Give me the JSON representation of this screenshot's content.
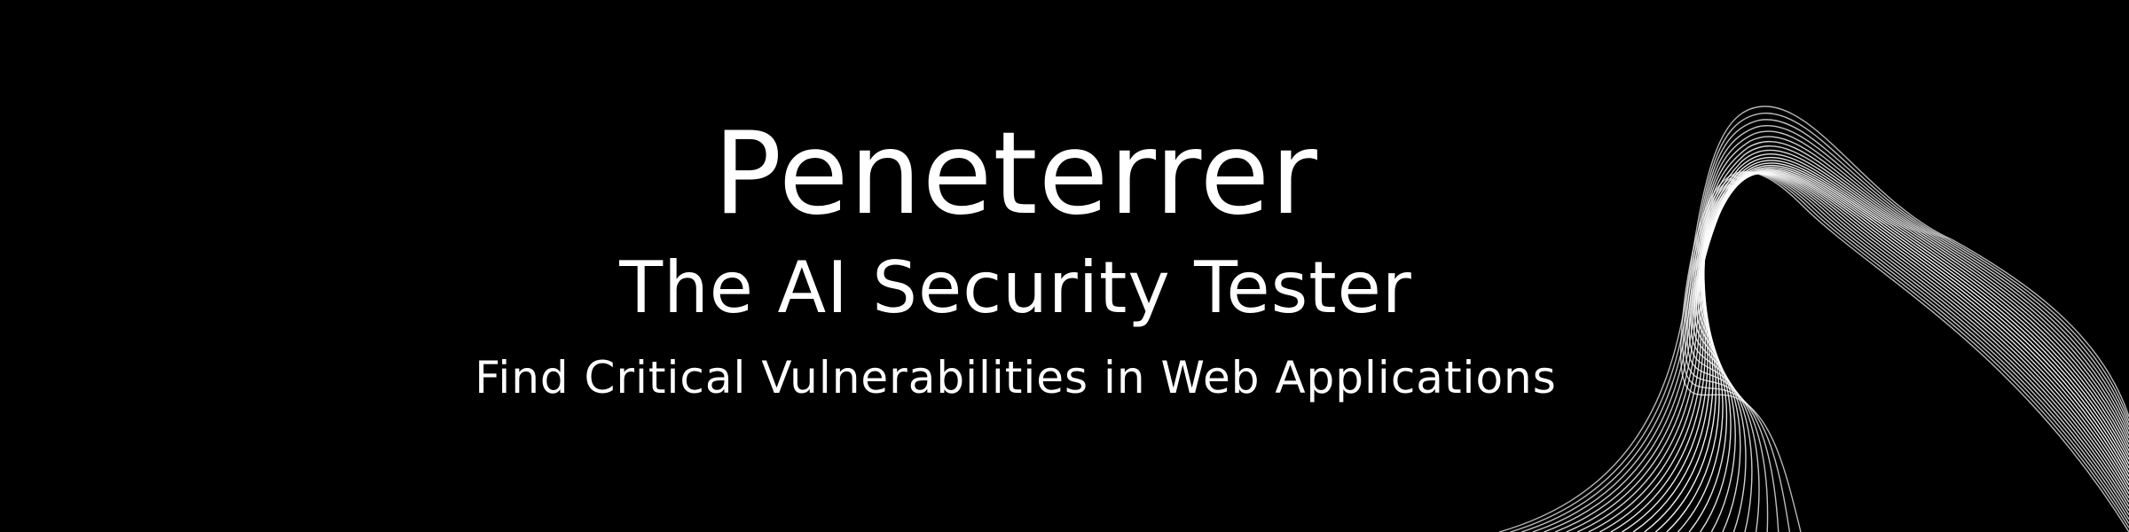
{
  "banner": {
    "title": "Peneterrer",
    "subtitle": "The AI Security Tester",
    "tagline": "Find Critical Vulnerabilities in Web Applications"
  },
  "colors": {
    "background": "#000000",
    "text": "#ffffff",
    "wave": "#ffffff"
  },
  "icons": {
    "decoration": "wave-lines-graphic"
  }
}
